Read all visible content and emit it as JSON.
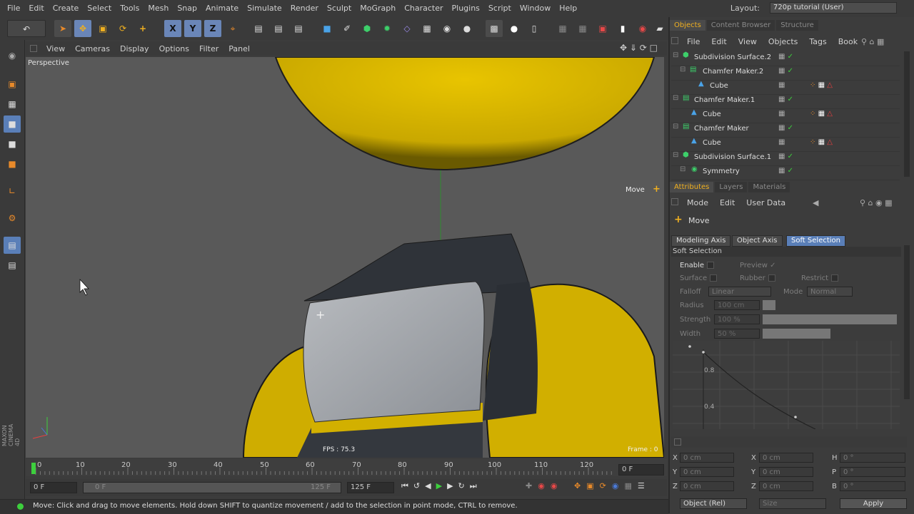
{
  "menubar": {
    "items": [
      "File",
      "Edit",
      "Create",
      "Select",
      "Tools",
      "Mesh",
      "Snap",
      "Animate",
      "Simulate",
      "Render",
      "Sculpt",
      "MoGraph",
      "Character",
      "Plugins",
      "Script",
      "Window",
      "Help"
    ],
    "layout_label": "Layout:",
    "layout_value": "720p tutorial (User)"
  },
  "toolbar": {
    "axis_x": "X",
    "axis_y": "Y",
    "axis_z": "Z"
  },
  "viewport": {
    "menu": [
      "View",
      "Cameras",
      "Display",
      "Options",
      "Filter",
      "Panel"
    ],
    "camera_label": "Perspective",
    "hud_tool": "Move",
    "fps": "FPS : 75.3",
    "frame": "Frame : 0"
  },
  "timeline": {
    "ticks": [
      "0",
      "10",
      "20",
      "30",
      "40",
      "50",
      "60",
      "70",
      "80",
      "90",
      "100",
      "110",
      "120"
    ],
    "current_frame": "0 F",
    "start_field": "0 F",
    "range_start": "0 F",
    "range_end": "125 F",
    "end_field": "125 F"
  },
  "statusbar": {
    "message": "Move: Click and drag to move elements. Hold down SHIFT to quantize movement / add to the selection in point mode, CTRL to remove."
  },
  "object_manager": {
    "tabs": [
      "Objects",
      "Content Browser",
      "Structure"
    ],
    "menu": [
      "File",
      "Edit",
      "View",
      "Objects",
      "Tags",
      "Book"
    ],
    "rows": [
      {
        "name": "Subdivision Surface.2",
        "indent": 0,
        "tags": false
      },
      {
        "name": "Chamfer Maker.2",
        "indent": 1,
        "tags": false
      },
      {
        "name": "Cube",
        "indent": 2,
        "tags": true
      },
      {
        "name": "Chamfer Maker.1",
        "indent": 0,
        "tags": false
      },
      {
        "name": "Cube",
        "indent": 1,
        "tags": true
      },
      {
        "name": "Chamfer Maker",
        "indent": 0,
        "tags": false
      },
      {
        "name": "Cube",
        "indent": 1,
        "tags": true
      },
      {
        "name": "Subdivision Surface.1",
        "indent": 0,
        "tags": false
      },
      {
        "name": "Symmetry",
        "indent": 1,
        "tags": false
      }
    ]
  },
  "attributes": {
    "tabs": [
      "Attributes",
      "Layers",
      "Materials"
    ],
    "menu": [
      "Mode",
      "Edit",
      "User Data"
    ],
    "tool_name": "Move",
    "subtabs": [
      "Modeling Axis",
      "Object Axis",
      "Soft Selection"
    ],
    "section": "Soft Selection",
    "enable": "Enable",
    "preview": "Preview",
    "surface": "Surface",
    "rubber": "Rubber",
    "restrict": "Restrict",
    "falloff_label": "Falloff",
    "falloff_value": "Linear",
    "mode_label": "Mode",
    "mode_value": "Normal",
    "radius_label": "Radius",
    "radius_value": "100 cm",
    "strength_label": "Strength",
    "strength_value": "100 %",
    "width_label": "Width",
    "width_value": "50 %",
    "graph_y1": "0.8",
    "graph_y2": "0.4"
  },
  "coords": {
    "pos": [
      {
        "axis": "X",
        "value": "0 cm"
      },
      {
        "axis": "Y",
        "value": "0 cm"
      },
      {
        "axis": "Z",
        "value": "0 cm"
      }
    ],
    "size": [
      {
        "axis": "X",
        "value": "0 cm"
      },
      {
        "axis": "Y",
        "value": "0 cm"
      },
      {
        "axis": "Z",
        "value": "0 cm"
      }
    ],
    "rot": [
      {
        "axis": "H",
        "value": "0 °"
      },
      {
        "axis": "P",
        "value": "0 °"
      },
      {
        "axis": "B",
        "value": "0 °"
      }
    ],
    "mode_value": "Object (Rel)",
    "size_value": "Size",
    "apply_label": "Apply"
  },
  "colors": {
    "accent": "#5a7fb8",
    "yellow": "#d4b400",
    "cube_gray": "#a8abb0"
  }
}
